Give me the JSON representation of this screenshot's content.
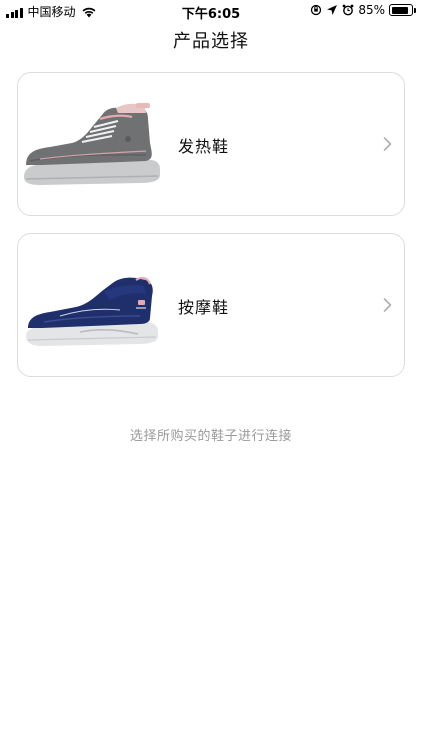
{
  "status_bar": {
    "carrier": "中国移动",
    "time": "下午6:05",
    "battery_percent_text": "85%",
    "battery_level": 0.85
  },
  "header": {
    "title": "产品选择"
  },
  "products": [
    {
      "label": "发热鞋",
      "image_icon": "grey-heated-sneaker"
    },
    {
      "label": "按摩鞋",
      "image_icon": "navy-massage-sneaker"
    }
  ],
  "hint_text": "选择所购买的鞋子进行连接",
  "colors": {
    "card_border": "#dcdcdc",
    "hint": "#9a9a9a",
    "chevron": "#b0b0b0"
  }
}
